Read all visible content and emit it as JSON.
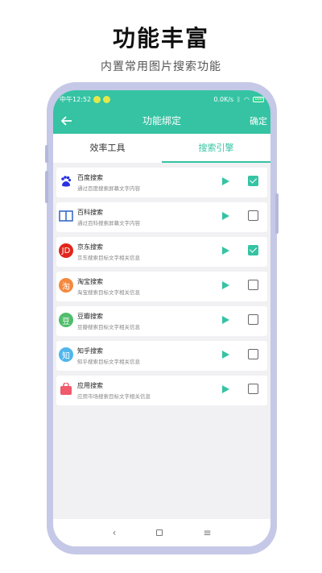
{
  "promo": {
    "title": "功能丰富",
    "subtitle": "内置常用图片搜索功能"
  },
  "status_bar": {
    "time": "中午12:52",
    "net_speed": "0.0K/s",
    "battery": "100"
  },
  "toolbar": {
    "title": "功能绑定",
    "confirm_label": "确定"
  },
  "tabs": [
    {
      "label": "效率工具",
      "active": false
    },
    {
      "label": "搜索引擎",
      "active": true
    }
  ],
  "items": [
    {
      "icon": "baidu-paw-icon",
      "name": "百度搜索",
      "desc": "通过百度搜索屏幕文字内容",
      "checked": true,
      "color": "#2932e1"
    },
    {
      "icon": "book-icon",
      "name": "百科搜索",
      "desc": "通过百科搜索屏幕文字内容",
      "checked": false,
      "color": "#2b62c7"
    },
    {
      "icon": "jd-icon",
      "name": "京东搜索",
      "desc": "京东搜索目标文字相关信息",
      "checked": true,
      "color": "#e1251b",
      "glyph": "JD"
    },
    {
      "icon": "taobao-icon",
      "name": "淘宝搜索",
      "desc": "淘宝搜索目标文字相关信息",
      "checked": false,
      "color": "#f5883c",
      "glyph": "淘"
    },
    {
      "icon": "douban-icon",
      "name": "豆瓣搜索",
      "desc": "豆瓣搜索目标文字相关信息",
      "checked": false,
      "color": "#4fbd6a",
      "glyph": "豆"
    },
    {
      "icon": "zhihu-icon",
      "name": "知乎搜索",
      "desc": "知乎搜索目标文字相关信息",
      "checked": false,
      "color": "#4fb6ec",
      "glyph": "知"
    },
    {
      "icon": "app-store-icon",
      "name": "应用搜索",
      "desc": "应用市场搜索目标文字相关信息",
      "checked": false,
      "color": "#f05a6b"
    }
  ],
  "colors": {
    "accent": "#35c3a3",
    "phone_frame": "#c5c8e6"
  }
}
